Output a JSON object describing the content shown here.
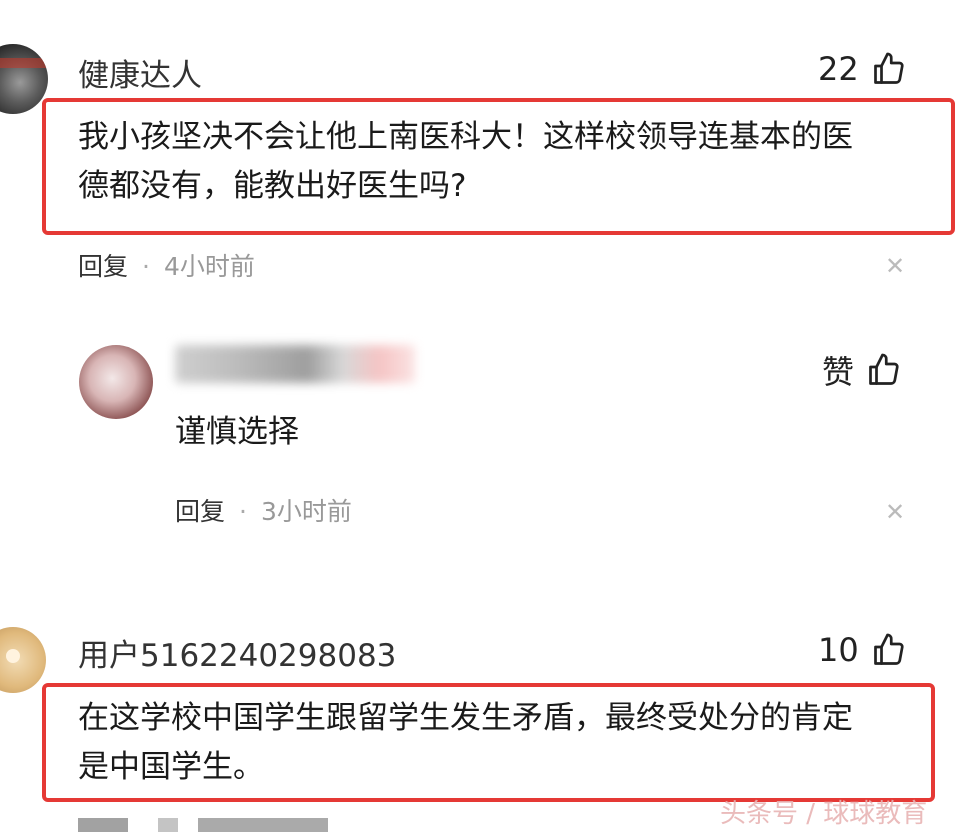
{
  "comments": [
    {
      "username": "健康达人",
      "likes": "22",
      "text_line1": "我小孩坚决不会让他上南医科大！这样校领导连基本的医",
      "text_line2": "德都没有，能教出好医生吗?",
      "reply_label": "回复",
      "time": "4小时前"
    },
    {
      "likes": "赞",
      "text": "谨慎选择",
      "reply_label": "回复",
      "time": "3小时前"
    },
    {
      "username": "用户5162240298083",
      "likes": "10",
      "text_line1": "在这学校中国学生跟留学生发生矛盾，最终受处分的肯定",
      "text_line2": "是中国学生。"
    }
  ],
  "watermark": "头条号 / 球球教育",
  "icons": {
    "like": "thumbs-up-icon",
    "close": "close-icon"
  },
  "colors": {
    "highlight_border": "#e53935",
    "meta_gray": "#999999"
  }
}
